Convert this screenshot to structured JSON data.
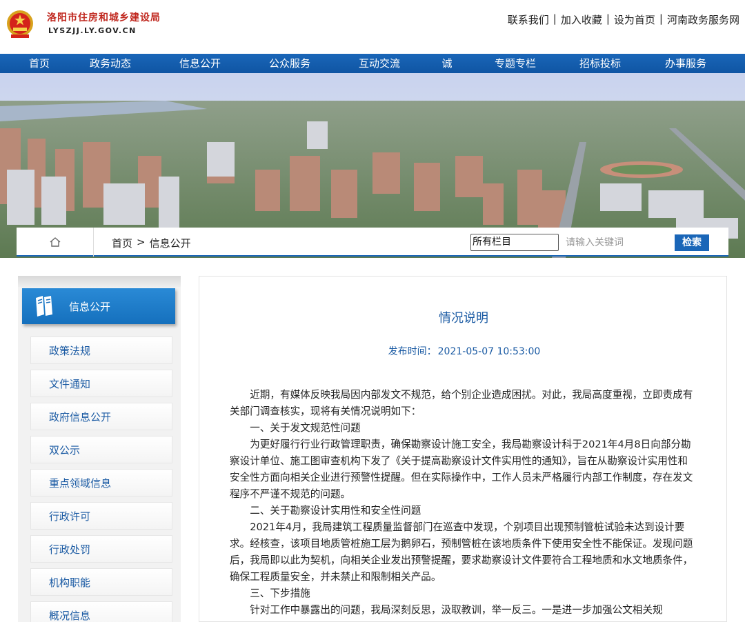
{
  "header": {
    "site_name": "洛阳市住房和城乡建设局",
    "site_domain": "LYSZJJ.LY.GOV.CN",
    "links": [
      "联系我们",
      "加入收藏",
      "设为首页",
      "河南政务服务网"
    ]
  },
  "nav": {
    "items": [
      "首页",
      "政务动态",
      "信息公开",
      "公众服务",
      "互动交流",
      "诚信建",
      "专题专栏",
      "招标投标",
      "办事服务"
    ]
  },
  "breadcrumb": {
    "items": [
      "首页",
      ">",
      "信息公开"
    ]
  },
  "search": {
    "scope": "所有栏目",
    "placeholder": "请输入关键词",
    "button": "检索"
  },
  "sidebar": {
    "title": "信息公开",
    "items": [
      "政策法规",
      "文件通知",
      "政府信息公开",
      "双公示",
      "重点领域信息",
      "行政许可",
      "行政处罚",
      "机构职能",
      "概况信息"
    ]
  },
  "article": {
    "title": "情况说明",
    "meta_label": "发布时间：",
    "meta_time": "2021-05-07 10:53:00",
    "paragraphs": [
      "近期，有媒体反映我局因内部发文不规范，给个别企业造成困扰。对此，我局高度重视，立即责成有关部门调查核实，现将有关情况说明如下：",
      "一、关于发文规范性问题",
      "为更好履行行业行政管理职责，确保勘察设计施工安全，我局勘察设计科于2021年4月8日向部分勘察设计单位、施工图审查机构下发了《关于提高勘察设计文件实用性的通知》，旨在从勘察设计实用性和安全性方面向相关企业进行预警性提醒。但在实际操作中，工作人员未严格履行内部工作制度，存在发文程序不严谨不规范的问题。",
      "二、关于勘察设计实用性和安全性问题",
      "2021年4月，我局建筑工程质量监督部门在巡查中发现，个别项目出现预制管桩试验未达到设计要求。经核查，该项目地质管桩施工层为鹅卵石，预制管桩在该地质条件下使用安全性不能保证。发现问题后，我局即以此为契机，向相关企业发出预警提醒，要求勘察设计文件要符合工程地质和水文地质条件，确保工程质量安全，并未禁止和限制相关产品。",
      "三、下步措施",
      "针对工作中暴露出的问题，我局深刻反思，汲取教训，举一反三。一是进一步加强公文相关规"
    ]
  },
  "colors": {
    "nav_blue": "#1a66b8",
    "brand_red": "#c0281f",
    "link_blue": "#1a5aa3"
  }
}
